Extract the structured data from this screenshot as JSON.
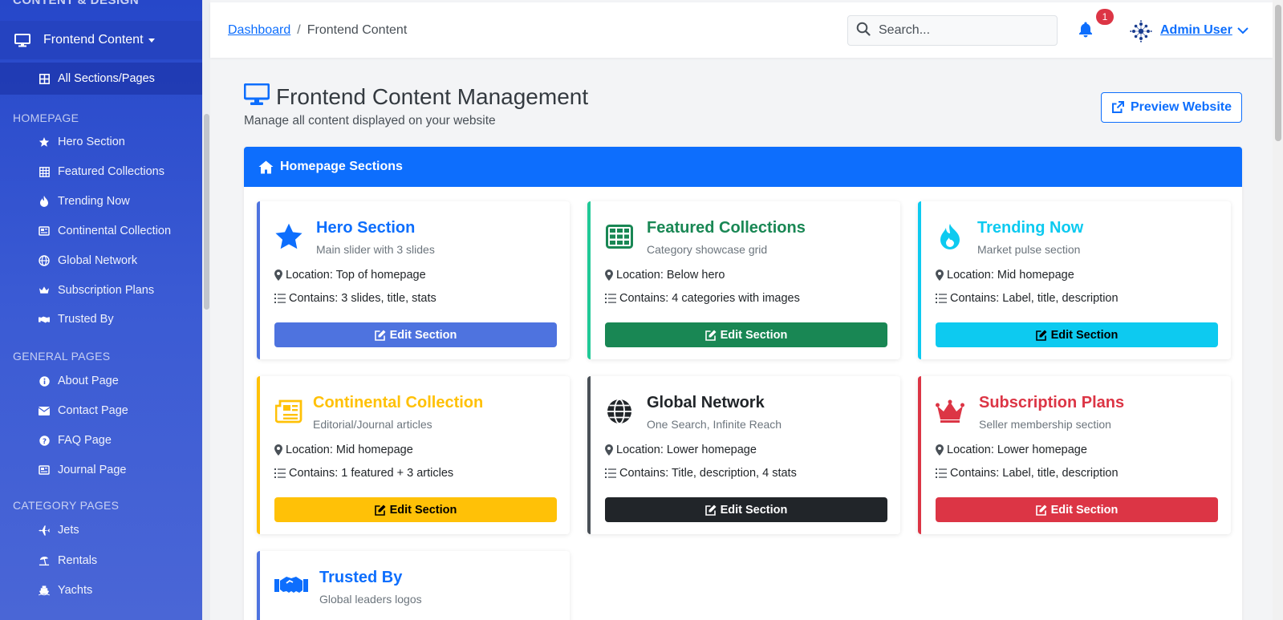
{
  "sidebar": {
    "section_cut": "CONTENT & DESIGN",
    "active_parent": "Frontend Content",
    "active_sub": "All Sections/Pages",
    "groups": [
      {
        "label": "HOMEPAGE",
        "items": [
          "Hero Section",
          "Featured Collections",
          "Trending Now",
          "Continental Collection",
          "Global Network",
          "Subscription Plans",
          "Trusted By"
        ]
      },
      {
        "label": "GENERAL PAGES",
        "items": [
          "About Page",
          "Contact Page",
          "FAQ Page",
          "Journal Page"
        ]
      },
      {
        "label": "CATEGORY PAGES",
        "items": [
          "Jets",
          "Rentals",
          "Yachts"
        ]
      }
    ]
  },
  "header": {
    "breadcrumb_link": "Dashboard",
    "breadcrumb_sep": "/",
    "breadcrumb_current": "Frontend Content",
    "search_placeholder": "Search...",
    "notifications_count": "1",
    "user_name": "Admin User"
  },
  "main": {
    "title": "Frontend Content Management",
    "subtitle": "Manage all content displayed on your website",
    "preview_label": "Preview Website",
    "panel_title": "Homepage Sections",
    "cards": [
      {
        "title": "Hero Section",
        "sub": "Main slider with 3 slides",
        "location": "Location: Top of homepage",
        "contains": "Contains: 3 slides, title, stats",
        "button": "Edit Section",
        "icon": "star-icon",
        "accent": "#4e73df"
      },
      {
        "title": "Featured Collections",
        "sub": "Category showcase grid",
        "location": "Location: Below hero",
        "contains": "Contains: 4 categories with images",
        "button": "Edit Section",
        "icon": "grid-icon",
        "accent": "#198754"
      },
      {
        "title": "Trending Now",
        "sub": "Market pulse section",
        "location": "Location: Mid homepage",
        "contains": "Contains: Label, title, description",
        "button": "Edit Section",
        "icon": "fire-icon",
        "accent": "#0dcaf0"
      },
      {
        "title": "Continental Collection",
        "sub": "Editorial/Journal articles",
        "location": "Location: Mid homepage",
        "contains": "Contains: 1 featured + 3 articles",
        "button": "Edit Section",
        "icon": "newspaper-icon",
        "accent": "#ffc107"
      },
      {
        "title": "Global Network",
        "sub": "One Search, Infinite Reach",
        "location": "Location: Lower homepage",
        "contains": "Contains: Title, description, 4 stats",
        "button": "Edit Section",
        "icon": "globe-icon",
        "accent": "#212529"
      },
      {
        "title": "Subscription Plans",
        "sub": "Seller membership section",
        "location": "Location: Lower homepage",
        "contains": "Contains: Label, title, description",
        "button": "Edit Section",
        "icon": "crown-icon",
        "accent": "#dc3545"
      },
      {
        "title": "Trusted By",
        "sub": "Global leaders logos",
        "location": "",
        "contains": "",
        "button": "",
        "icon": "handshake-icon",
        "accent": "#4e73df"
      }
    ]
  }
}
